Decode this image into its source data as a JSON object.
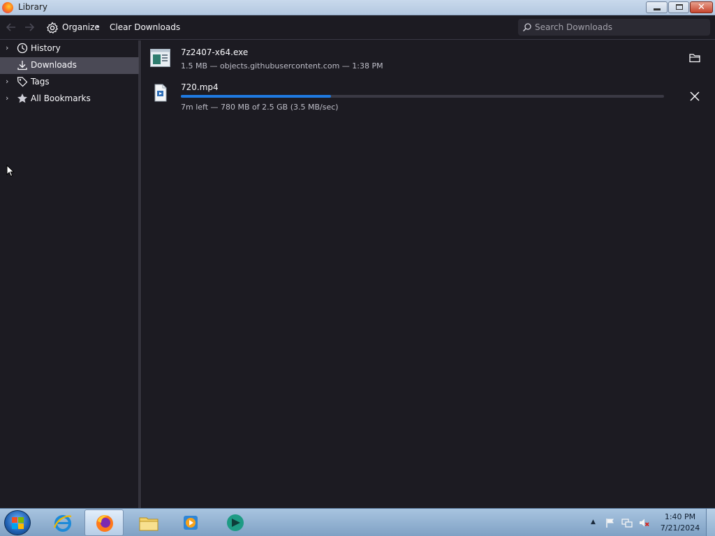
{
  "window": {
    "title": "Library",
    "controls": {
      "minimize": "minimize",
      "maximize": "restore",
      "close": "close"
    }
  },
  "toolbar": {
    "organize_label": "Organize",
    "clear_downloads_label": "Clear Downloads",
    "search_placeholder": "Search Downloads"
  },
  "sidebar": {
    "items": [
      {
        "label": "History",
        "icon": "clock-icon",
        "expandable": true,
        "selected": false
      },
      {
        "label": "Downloads",
        "icon": "download-icon",
        "expandable": false,
        "selected": true
      },
      {
        "label": "Tags",
        "icon": "tag-icon",
        "expandable": true,
        "selected": false
      },
      {
        "label": "All Bookmarks",
        "icon": "star-icon",
        "expandable": true,
        "selected": false
      }
    ]
  },
  "downloads": [
    {
      "name": "7z2407-x64.exe",
      "status": "1.5 MB — objects.githubusercontent.com — 1:38 PM",
      "icon": "executable-file-icon",
      "action": "open-folder-icon",
      "state": "completed"
    },
    {
      "name": "720.mp4",
      "status": "7m left — 780 MB of 2.5 GB (3.5 MB/sec)",
      "icon": "video-file-icon",
      "action": "cancel-icon",
      "state": "in-progress",
      "progress_fraction": 0.31
    }
  ],
  "taskbar": {
    "apps": [
      "internet-explorer-icon",
      "firefox-icon",
      "file-explorer-icon",
      "media-player-icon",
      "app-icon"
    ],
    "active_app": "firefox-icon",
    "tray_icons": [
      "action-center-flag-icon",
      "network-icon",
      "volume-muted-icon"
    ],
    "clock_time": "1:40 PM",
    "clock_date": "7/21/2024"
  },
  "colors": {
    "background": "#1c1b22",
    "selected_row": "#4a4955",
    "progress_fill": "#1f7ae0",
    "text_primary": "#fbfbfe",
    "text_secondary": "#bfbfc9"
  }
}
